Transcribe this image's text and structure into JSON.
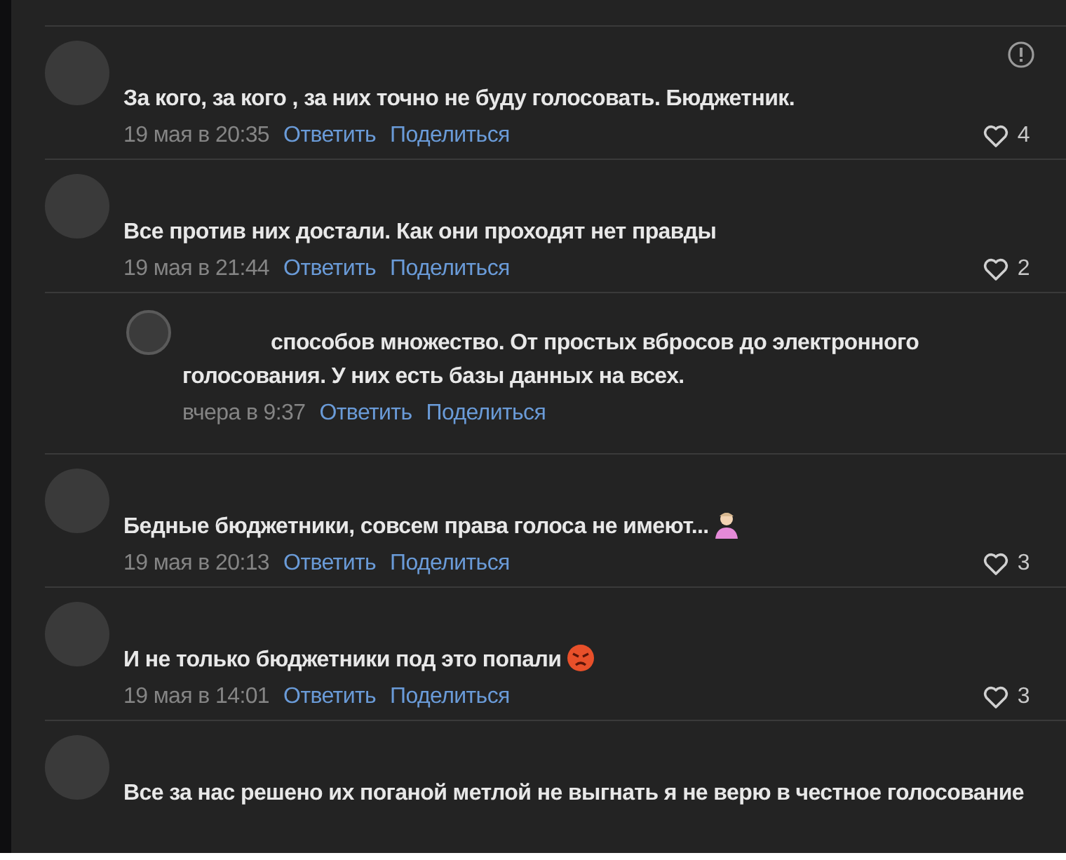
{
  "comments": [
    {
      "kind": "comment",
      "text": "За кого, за кого , за них точно не буду голосовать. Бюджетник.",
      "date": "19 мая в 20:35",
      "reply": "Ответить",
      "share": "Поделиться",
      "likes": "4",
      "report": true
    },
    {
      "kind": "comment",
      "text": "Все против них достали. Как они проходят нет правды",
      "date": "19 мая в 21:44",
      "reply": "Ответить",
      "share": "Поделиться",
      "likes": "2",
      "report": false
    },
    {
      "kind": "reply",
      "text": "способов множество. От простых вбросов до электронного голосования. У них есть базы данных на всех.",
      "date": "вчера в 9:37",
      "reply": "Ответить",
      "share": "Поделиться",
      "report": false
    },
    {
      "kind": "comment",
      "text": "Бедные бюджетники, совсем права голоса не имеют...",
      "emoji": {
        "kind": "person"
      },
      "date": "19 мая в 20:13",
      "reply": "Ответить",
      "share": "Поделиться",
      "likes": "3",
      "report": false
    },
    {
      "kind": "comment",
      "text": "И не только бюджетники под это попали",
      "emoji": {
        "kind": "angry"
      },
      "date": "19 мая в 14:01",
      "reply": "Ответить",
      "share": "Поделиться",
      "likes": "3",
      "report": false
    },
    {
      "kind": "comment",
      "text": "Все за нас решено их поганой метлой не выгнать я не верю в честное голосование",
      "report": false
    }
  ]
}
